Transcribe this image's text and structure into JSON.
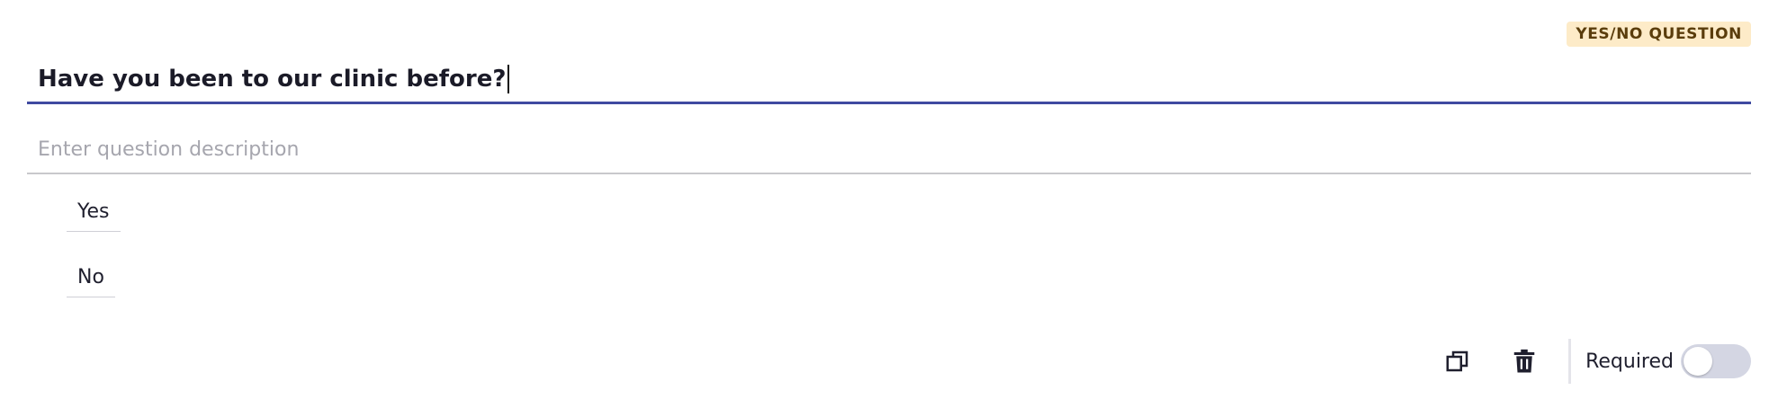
{
  "question": {
    "type_badge": "YES/NO QUESTION",
    "title": "Have you been to our clinic before?",
    "description_placeholder": "Enter question description",
    "options": [
      {
        "label": "Yes"
      },
      {
        "label": "No"
      }
    ]
  },
  "toolbar": {
    "duplicate_icon": "duplicate-icon",
    "delete_icon": "trash-icon",
    "required_label": "Required",
    "required_enabled": false
  },
  "colors": {
    "accent_underline": "#3f4aa0",
    "badge_bg": "#fdebc8",
    "badge_text": "#5a3d0c",
    "toggle_off": "#d4d6e3"
  }
}
